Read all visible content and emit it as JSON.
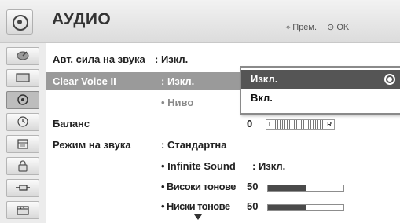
{
  "header": {
    "title": "АУДИО",
    "nav_move": "Прем.",
    "nav_ok": "OK"
  },
  "sidebar": {
    "items": [
      {
        "icon": "satellite-dish-icon",
        "selected": false
      },
      {
        "icon": "monitor-icon",
        "selected": false
      },
      {
        "icon": "speaker-icon",
        "selected": true
      },
      {
        "icon": "clock-icon",
        "selected": false
      },
      {
        "icon": "calendar-icon",
        "selected": false
      },
      {
        "icon": "lock-icon",
        "selected": false
      },
      {
        "icon": "usb-plug-icon",
        "selected": false
      },
      {
        "icon": "film-icon",
        "selected": false
      }
    ]
  },
  "menu": {
    "auto_volume": {
      "label": "Авт. сила на звука",
      "value": ": Изкл."
    },
    "clear_voice": {
      "label": "Clear Voice II",
      "value": ": Изкл."
    },
    "level": {
      "label": "• Ниво"
    },
    "balance": {
      "label": "Баланс",
      "value": "0",
      "left_mark": "L",
      "right_mark": "R"
    },
    "sound_mode": {
      "label": "Режим на звука",
      "value": ": Стандартна"
    },
    "infinite_sound": {
      "label": "• Infinite Sound",
      "value": ": Изкл."
    },
    "treble": {
      "label": "• Високи тонове",
      "value": "50",
      "level": 0.5
    },
    "bass": {
      "label": "• Ниски тонове",
      "value": "50",
      "level": 0.5
    }
  },
  "popup": {
    "options": [
      "Изкл.",
      "Вкл."
    ],
    "selected_index": 0
  }
}
